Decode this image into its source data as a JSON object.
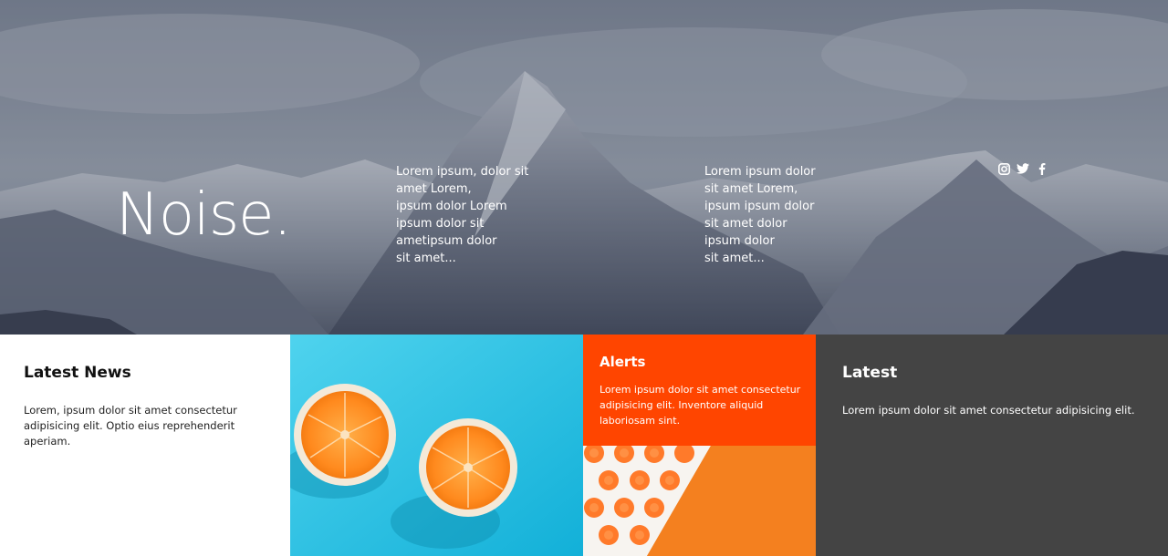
{
  "hero": {
    "brand": "Noise.",
    "column1_text": "Lorem ipsum, dolor sit\namet Lorem,\nipsum dolor Lorem\nipsum dolor sit\nametipsum dolor\nsit amet...",
    "column2_text": "Lorem ipsum dolor\nsit amet Lorem,\nipsum ipsum dolor\nsit amet dolor\nipsum dolor\nsit amet...",
    "social_icons": [
      "instagram-icon",
      "twitter-icon",
      "facebook-icon"
    ]
  },
  "latest_news": {
    "title": "Latest News",
    "body": "Lorem, ipsum dolor sit amet consectetur adipisicing elit. Optio eius reprehenderit aperiam."
  },
  "alerts": {
    "title": "Alerts",
    "body": "Lorem ipsum dolor sit amet consectetur adipisicing elit. Inventore aliquid laboriosam sint."
  },
  "latest": {
    "title": "Latest",
    "body": "Lorem ipsum dolor sit amet consectetur adipisicing elit."
  },
  "colors": {
    "alerts_accent": "#ff4500",
    "latest_bg": "#444444",
    "oranges_bg": "#2ec6e6",
    "text_light": "#ffffff",
    "text_dark": "#111111"
  }
}
